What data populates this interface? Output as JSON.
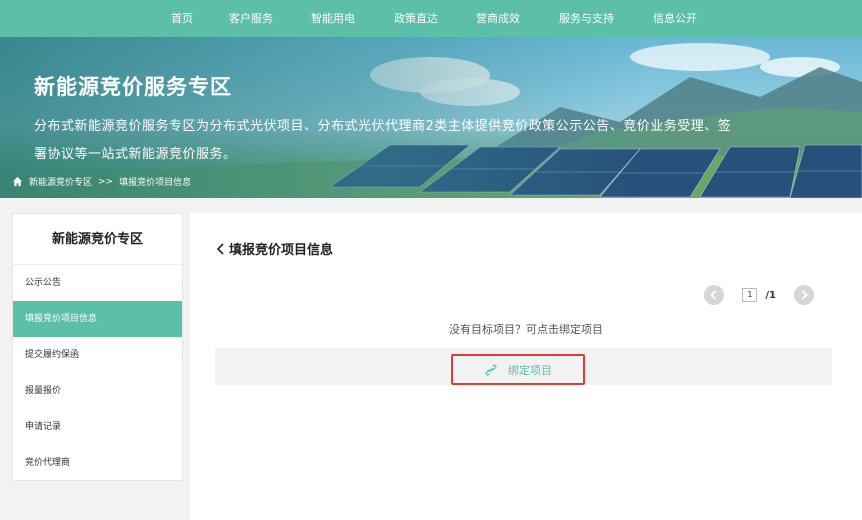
{
  "nav": {
    "items": [
      "首页",
      "客户服务",
      "智能用电",
      "政策直达",
      "营商成效",
      "服务与支持",
      "信息公开"
    ]
  },
  "hero": {
    "title": "新能源竞价服务专区",
    "description": "分布式新能源竞价服务专区为分布式光伏项目、分布式光伏代理商2类主体提供竞价政策公示公告、竞价业务受理、签署协议等一站式新能源竞价服务。",
    "breadcrumb": {
      "home": "新能源竞价专区",
      "separator": ">>",
      "current": "填报竞价项目信息"
    }
  },
  "sidebar": {
    "title": "新能源竞价专区",
    "items": [
      {
        "label": "公示公告",
        "active": false
      },
      {
        "label": "填报竞价项目信息",
        "active": true
      },
      {
        "label": "提交履约保函",
        "active": false
      },
      {
        "label": "报量报价",
        "active": false
      },
      {
        "label": "申请记录",
        "active": false
      },
      {
        "label": "竞价代理商",
        "active": false
      }
    ]
  },
  "main": {
    "title": "填报竞价项目信息",
    "pager": {
      "current": "1",
      "total": "/1"
    },
    "hint": "没有目标项目？可点击绑定项目",
    "bind_label": "绑定项目"
  },
  "colors": {
    "accent": "#5cbfa7",
    "highlight": "#e53935"
  },
  "icons": {
    "home": "home-icon",
    "back": "chevron-left-icon",
    "link": "link-icon"
  }
}
